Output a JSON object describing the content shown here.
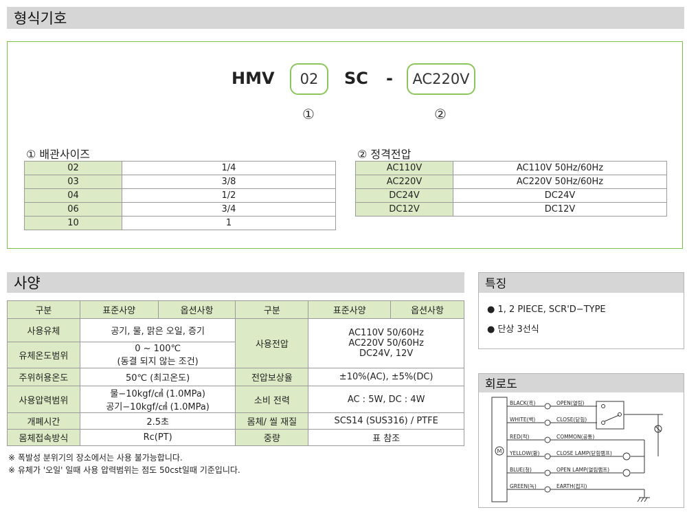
{
  "sections": {
    "model_title": "형식기호",
    "spec_title": "사양",
    "features_title": "특징",
    "circuit_title": "회로도"
  },
  "model_code": {
    "prefix": "HMV",
    "size_code": "02",
    "mid": "SC",
    "dash": "-",
    "voltage_code": "AC220V",
    "marker1": "①",
    "marker2": "②"
  },
  "pipe_size_table": {
    "title": "① 배관사이즈",
    "rows": [
      [
        "02",
        "1/4"
      ],
      [
        "03",
        "3/8"
      ],
      [
        "04",
        "1/2"
      ],
      [
        "06",
        "3/4"
      ],
      [
        "10",
        "1"
      ]
    ]
  },
  "voltage_table": {
    "title": "② 정격전압",
    "rows": [
      [
        "AC110V",
        "AC110V 50Hz/60Hz"
      ],
      [
        "AC220V",
        "AC220V 50Hz/60Hz"
      ],
      [
        "DC24V",
        "DC24V"
      ],
      [
        "DC12V",
        "DC12V"
      ]
    ]
  },
  "spec_table": {
    "headers": [
      "구분",
      "표준사양",
      "옵션사항",
      "구분",
      "표준사양",
      "옵션사항"
    ],
    "left": [
      {
        "label": "사용유체",
        "value": "공기, 물, 맑은 오일, 증기"
      },
      {
        "label": "유체온도범위",
        "value": "0 ~ 100℃",
        "value2": "(동결 되지 않는 조건)"
      },
      {
        "label": "주위허용온도",
        "value": "50℃ (최고온도)"
      },
      {
        "label": "사용압력범위",
        "value": "물−10kgf/㎠ (1.0MPa)",
        "value2": "공기−10kgf/㎠ (1.0MPa)"
      },
      {
        "label": "개폐시간",
        "value": "2.5초"
      },
      {
        "label": "몸체접속방식",
        "value": "Rc(PT)"
      }
    ],
    "right": [
      {
        "label": "사용전압",
        "value": "AC110V 50/60Hz",
        "value2": "AC220V 50/60Hz",
        "value3": "DC24V, 12V"
      },
      {
        "label": "전압보상율",
        "value": "±10%(AC), ±5%(DC)"
      },
      {
        "label": "소비 전력",
        "value": "AC : 5W, DC : 4W"
      },
      {
        "label": "몸체/ 씰 재질",
        "value": "SCS14 (SUS316) / PTFE"
      },
      {
        "label": "중량",
        "value": "표 참조"
      }
    ]
  },
  "notes": [
    "※ 폭발성 분위기의 장소에서는 사용 불가능합니다.",
    "※ 유체가 '오일' 일때 사용 압력범위는 점도 50cst일때 기준입니다."
  ],
  "features": [
    "● 1, 2 PIECE, SCR'D−TYPE",
    "● 단상 3선식"
  ],
  "circuit": {
    "motor": "M",
    "wires": [
      {
        "color": "BLACK(흑)",
        "func": "OPEN(열림)"
      },
      {
        "color": "WHITE(백)",
        "func": "CLOSE(닫힘)"
      },
      {
        "color": "RED(적)",
        "func": "COMMON(공통)"
      },
      {
        "color": "YELLOW(황)",
        "func": "CLOSE LAMP(닫힘램프)"
      },
      {
        "color": "BLUE(청)",
        "func": "OPEN LAMP(열림램프)"
      },
      {
        "color": "GREEN(녹)",
        "func": "EARTH(접지)"
      }
    ]
  }
}
